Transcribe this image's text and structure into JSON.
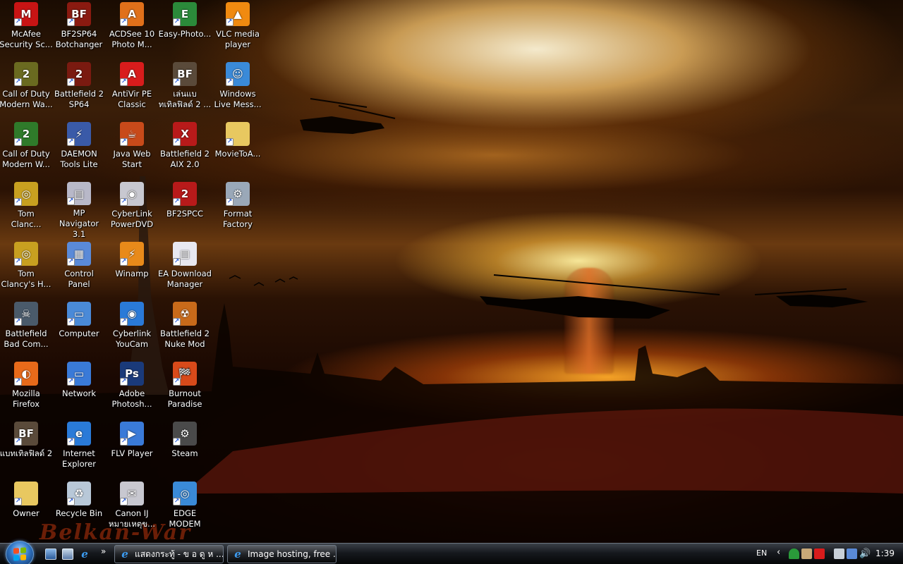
{
  "wallpaper": {
    "signature": "Belkan-War"
  },
  "icons": [
    {
      "label": "McAfee\nSecurity Sc...",
      "icon": "mcafee-icon",
      "color": "#c81414",
      "glyph": "M",
      "col": 0,
      "row": 0
    },
    {
      "label": "BF2SP64\nBotchanger",
      "icon": "bf2-botchanger-icon",
      "color": "#8a1a10",
      "glyph": "BF",
      "col": 1,
      "row": 0
    },
    {
      "label": "ACDSee 10\nPhoto M...",
      "icon": "acdsee-icon",
      "color": "#e0701a",
      "glyph": "A",
      "col": 2,
      "row": 0
    },
    {
      "label": "Easy-Photo...",
      "icon": "easy-photo-icon",
      "color": "#2b8a3a",
      "glyph": "E",
      "col": 3,
      "row": 0
    },
    {
      "label": "VLC media\nplayer",
      "icon": "vlc-cone-icon",
      "color": "#f08a10",
      "glyph": "▲",
      "col": 4,
      "row": 0
    },
    {
      "label": "Call of Duty\nModern Wa...",
      "icon": "cod-icon",
      "color": "#6a6a20",
      "glyph": "2",
      "col": 0,
      "row": 1
    },
    {
      "label": "Battlefield 2\nSP64",
      "icon": "bf2-sp64-icon",
      "color": "#7a1a10",
      "glyph": "2",
      "col": 1,
      "row": 1
    },
    {
      "label": "AntiVir PE\nClassic",
      "icon": "antivir-icon",
      "color": "#d81c1c",
      "glyph": "A",
      "col": 2,
      "row": 1
    },
    {
      "label": "เล่นแบ\nทเทิลฟิลด์ 2 ...",
      "icon": "battlefield-thai-icon",
      "color": "#5a4a3a",
      "glyph": "BF",
      "col": 3,
      "row": 1
    },
    {
      "label": "Windows\nLive Mess...",
      "icon": "messenger-icon",
      "color": "#3a8ad8",
      "glyph": "☺",
      "col": 4,
      "row": 1
    },
    {
      "label": "Call of Duty\nModern W...",
      "icon": "cod2-icon",
      "color": "#2f7a2a",
      "glyph": "2",
      "col": 0,
      "row": 2
    },
    {
      "label": "DAEMON\nTools Lite",
      "icon": "daemon-tools-icon",
      "color": "#3a5aa8",
      "glyph": "⚡",
      "col": 1,
      "row": 2
    },
    {
      "label": "Java Web\nStart",
      "icon": "java-icon",
      "color": "#c84a1a",
      "glyph": "☕",
      "col": 2,
      "row": 2
    },
    {
      "label": "Battlefield 2\nAIX 2.0",
      "icon": "bf2-aix-icon",
      "color": "#b81a1a",
      "glyph": "X",
      "col": 3,
      "row": 2
    },
    {
      "label": "MovieToA...",
      "icon": "folder-icon",
      "color": "#e8c860",
      "glyph": "",
      "col": 4,
      "row": 2
    },
    {
      "label": "Tom\nClanc...",
      "icon": "tom-clancy-icon",
      "color": "#c8a020",
      "glyph": "◎",
      "col": 0,
      "row": 3
    },
    {
      "label": "MP\nNavigator 3.1",
      "icon": "mp-navigator-icon",
      "color": "#b8b8c8",
      "glyph": "▤",
      "col": 1,
      "row": 3
    },
    {
      "label": "CyberLink\nPowerDVD",
      "icon": "powerdvd-icon",
      "color": "#c8c8d0",
      "glyph": "◉",
      "col": 2,
      "row": 3
    },
    {
      "label": "BF2SPCC",
      "icon": "bf2spcc-icon",
      "color": "#b81a1a",
      "glyph": "2",
      "col": 3,
      "row": 3
    },
    {
      "label": "Format\nFactory",
      "icon": "format-factory-icon",
      "color": "#9aa8b8",
      "glyph": "⚙",
      "col": 4,
      "row": 3
    },
    {
      "label": "Tom\nClancy's H...",
      "icon": "tom-clancy-hawx-icon",
      "color": "#c8a020",
      "glyph": "◎",
      "col": 0,
      "row": 4
    },
    {
      "label": "Control\nPanel",
      "icon": "control-panel-icon",
      "color": "#5a8ad8",
      "glyph": "▦",
      "col": 1,
      "row": 4
    },
    {
      "label": "Winamp",
      "icon": "winamp-icon",
      "color": "#e88a1a",
      "glyph": "⚡",
      "col": 2,
      "row": 4
    },
    {
      "label": "EA Download\nManager",
      "icon": "ea-download-icon",
      "color": "#e8e8f0",
      "glyph": "▤",
      "col": 3,
      "row": 4
    },
    {
      "label": "Battlefield\nBad Com...",
      "icon": "bad-company-icon",
      "color": "#4a5a6a",
      "glyph": "☠",
      "col": 0,
      "row": 5
    },
    {
      "label": "Computer",
      "icon": "computer-icon",
      "color": "#4a8ad8",
      "glyph": "▭",
      "col": 1,
      "row": 5
    },
    {
      "label": "Cyberlink\nYouCam",
      "icon": "youcam-icon",
      "color": "#2a7ad8",
      "glyph": "◉",
      "col": 2,
      "row": 5
    },
    {
      "label": "Battlefield 2\nNuke Mod",
      "icon": "nuke-mod-icon",
      "color": "#c86a1a",
      "glyph": "☢",
      "col": 3,
      "row": 5
    },
    {
      "label": "Mozilla\nFirefox",
      "icon": "firefox-icon",
      "color": "#e86a1a",
      "glyph": "◐",
      "col": 0,
      "row": 6
    },
    {
      "label": "Network",
      "icon": "network-icon",
      "color": "#3a7ad8",
      "glyph": "▭",
      "col": 1,
      "row": 6
    },
    {
      "label": "Adobe\nPhotosh...",
      "icon": "photoshop-icon",
      "color": "#1a3a7a",
      "glyph": "Ps",
      "col": 2,
      "row": 6
    },
    {
      "label": "Burnout\nParadise",
      "icon": "burnout-icon",
      "color": "#d84a1a",
      "glyph": "🏁",
      "col": 3,
      "row": 6
    },
    {
      "label": "แบทเทิลฟิลด์ 2",
      "icon": "battlefield2-thai-icon",
      "color": "#5a4a3a",
      "glyph": "BF",
      "col": 0,
      "row": 7
    },
    {
      "label": "Internet\nExplorer",
      "icon": "internet-explorer-icon",
      "color": "#2a7ad8",
      "glyph": "e",
      "col": 1,
      "row": 7
    },
    {
      "label": "FLV Player",
      "icon": "flv-player-icon",
      "color": "#3a7ad8",
      "glyph": "▶",
      "col": 2,
      "row": 7
    },
    {
      "label": "Steam",
      "icon": "steam-icon",
      "color": "#4a4a4a",
      "glyph": "⚙",
      "col": 3,
      "row": 7
    },
    {
      "label": "Owner",
      "icon": "user-folder-icon",
      "color": "#e8c860",
      "glyph": "",
      "col": 0,
      "row": 8
    },
    {
      "label": "Recycle Bin",
      "icon": "recycle-bin-icon",
      "color": "#b8c8d8",
      "glyph": "♻",
      "col": 1,
      "row": 8
    },
    {
      "label": "Canon IJ\nหมายเหตุข...",
      "icon": "canon-ij-icon",
      "color": "#c8c8d0",
      "glyph": "✉",
      "col": 2,
      "row": 8
    },
    {
      "label": "EDGE\nMODEM",
      "icon": "edge-modem-icon",
      "color": "#3a8ad8",
      "glyph": "◎",
      "col": 3,
      "row": 8
    }
  ],
  "taskbar": {
    "windows": [
      {
        "title": "แสดงกระทู้ - ข อ ดู ห ..."
      },
      {
        "title": "Image hosting, free ..."
      }
    ],
    "quick_launch_chevron": "»",
    "tray": {
      "language": "EN",
      "expand_arrow": "‹",
      "clock": "1:39"
    }
  }
}
